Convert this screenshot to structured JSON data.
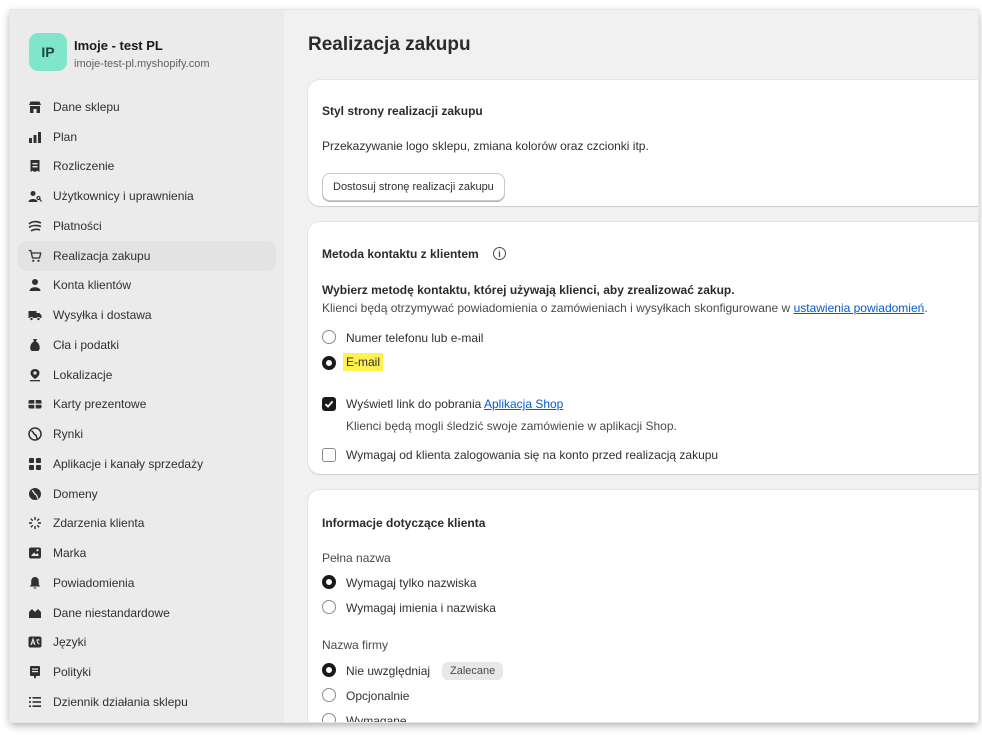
{
  "store": {
    "initials": "IP",
    "name": "Imoje - test PL",
    "domain": "imoje-test-pl.myshopify.com"
  },
  "sidebar": {
    "items": [
      {
        "label": "Dane sklepu",
        "icon": "store-icon"
      },
      {
        "label": "Plan",
        "icon": "plan-icon"
      },
      {
        "label": "Rozliczenie",
        "icon": "billing-icon"
      },
      {
        "label": "Użytkownicy i uprawnienia",
        "icon": "users-icon"
      },
      {
        "label": "Płatności",
        "icon": "payments-icon"
      },
      {
        "label": "Realizacja zakupu",
        "icon": "cart-icon",
        "active": true
      },
      {
        "label": "Konta klientów",
        "icon": "person-icon"
      },
      {
        "label": "Wysyłka i dostawa",
        "icon": "truck-icon"
      },
      {
        "label": "Cła i podatki",
        "icon": "tax-icon"
      },
      {
        "label": "Lokalizacje",
        "icon": "location-icon"
      },
      {
        "label": "Karty prezentowe",
        "icon": "gift-card-icon"
      },
      {
        "label": "Rynki",
        "icon": "globe-icon"
      },
      {
        "label": "Aplikacje i kanały sprzedaży",
        "icon": "apps-icon"
      },
      {
        "label": "Domeny",
        "icon": "domain-globe-icon"
      },
      {
        "label": "Zdarzenia klienta",
        "icon": "sparkle-icon"
      },
      {
        "label": "Marka",
        "icon": "brand-icon"
      },
      {
        "label": "Powiadomienia",
        "icon": "bell-icon"
      },
      {
        "label": "Dane niestandardowe",
        "icon": "metafields-icon"
      },
      {
        "label": "Języki",
        "icon": "languages-icon"
      },
      {
        "label": "Polityki",
        "icon": "policy-icon"
      },
      {
        "label": "Dziennik działania sklepu",
        "icon": "list-icon"
      }
    ]
  },
  "main": {
    "title": "Realizacja zakupu",
    "style_card": {
      "title": "Styl strony realizacji zakupu",
      "description": "Przekazywanie logo sklepu, zmiana kolorów oraz czcionki itp.",
      "button": "Dostosuj stronę realizacji zakupu"
    },
    "contact_card": {
      "title": "Metoda kontaktu z klientem",
      "info_glyph": "i",
      "prompt": "Wybierz metodę kontaktu, której używają klienci, aby zrealizować zakup.",
      "note_prefix": "Klienci będą otrzymywać powiadomienia o zamówieniach i wysyłkach skonfigurowane w ",
      "note_link": "ustawienia powiadomień",
      "note_suffix": ".",
      "option_phone_email": "Numer telefonu lub e-mail",
      "option_email": "E-mail",
      "selected": "E-mail",
      "shop_checkbox_prefix": "Wyświetl link do pobrania ",
      "shop_link": "Aplikacja Shop",
      "shop_checked": true,
      "shop_help": "Klienci będą mogli śledzić swoje zamówienie w aplikacji Shop.",
      "login_checkbox": "Wymagaj od klienta zalogowania się na konto przed realizacją zakupu",
      "login_checked": false
    },
    "customer_card": {
      "title": "Informacje dotyczące klienta",
      "full_name_label": "Pełna nazwa",
      "full_name_options": [
        "Wymagaj tylko nazwiska",
        "Wymagaj imienia i nazwiska"
      ],
      "full_name_selected": "Wymagaj tylko nazwiska",
      "company_label": "Nazwa firmy",
      "company_options": [
        "Nie uwzględniaj",
        "Opcjonalnie",
        "Wymagane"
      ],
      "company_selected": "Nie uwzględniaj",
      "recommended_badge": "Zalecane"
    }
  }
}
